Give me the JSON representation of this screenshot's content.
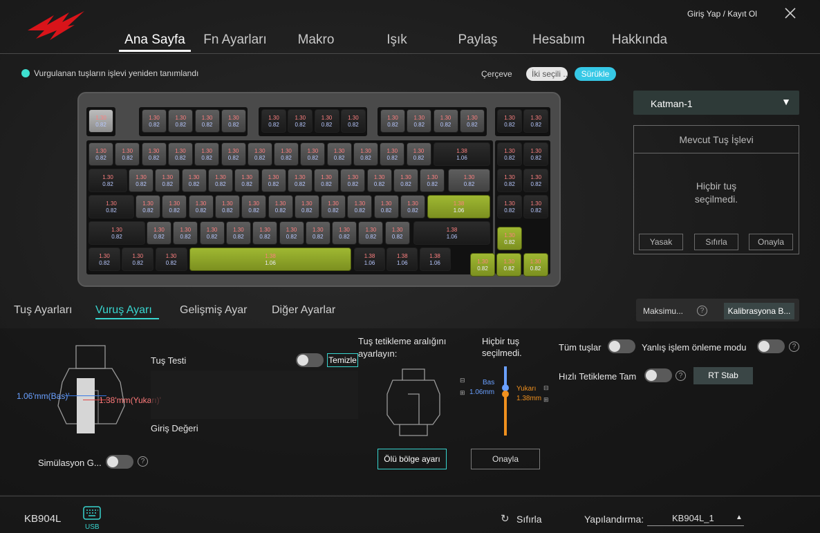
{
  "header": {
    "login": "Giriş Yap / Kayıt Ol",
    "nav": [
      "Ana Sayfa",
      "Fn Ayarları",
      "Makro",
      "Işık",
      "Paylaş",
      "Hesabım",
      "Hakkında"
    ],
    "active_nav": "Ana Sayfa"
  },
  "status": {
    "text": "Vurgulanan tuşların işlevi yeniden tanımlandı",
    "frame_label": "Çerçeve",
    "pill_select": "İki seçili ...",
    "pill_drag": "Sürükle"
  },
  "keycap": {
    "standard_top": "1.30",
    "standard_bottom": "0.82",
    "alt_top": "1.38",
    "alt_bottom": "1.06"
  },
  "right_panel": {
    "layer": "Katman-1",
    "fn_title": "Mevcut Tuş İşlevi",
    "fn_empty_line1": "Hiçbir tuş",
    "fn_empty_line2": "seçilmedi.",
    "buttons": [
      "Yasak",
      "Sıfırla",
      "Onayla"
    ]
  },
  "tabs": [
    "Tuş Ayarları",
    "Vuruş Ayarı",
    "Gelişmiş Ayar",
    "Diğer Ayarlar"
  ],
  "active_tab": "Vuruş Ayarı",
  "max_label": "Maksimu...",
  "calibration": "Kalibrasyona B...",
  "stroke": {
    "bas_label": "1.06'mm(Bas)'",
    "yukari_label": "1.38'mm(Yukarı)'",
    "key_test": "Tuş Testi",
    "clear": "Temizle",
    "input_value": "Giriş Değeri",
    "simulation": "Simülasyon G...",
    "trigger_title_1": "Tuş tetikleme aralığını",
    "trigger_title_2": "ayarlayın:",
    "no_key_1": "Hiçbir tuş",
    "no_key_2": "seçilmedi.",
    "slider_bas": "Bas",
    "slider_bas_val": "1.06mm",
    "slider_yukari": "Yukarı",
    "slider_yukari_val": "1.38mm",
    "dead_zone": "Ölü bölge ayarı",
    "confirm": "Onayla",
    "all_keys": "Tüm tuşlar",
    "misop": "Yanlış işlem önleme modu",
    "rapid": "Hızlı Tetikleme Tam",
    "rt_stab": "RT Stab"
  },
  "footer": {
    "model": "KB904L",
    "usb": "USB",
    "reset": "Sıfırla",
    "config_label": "Yapılandırma:",
    "config_value": "KB904L_1"
  },
  "colors": {
    "accent": "#38d6d0",
    "lime": "#9fb832",
    "drag_pill": "#36c8e6",
    "slider_blue": "#6aa0ff",
    "slider_orange": "#f0901e"
  }
}
